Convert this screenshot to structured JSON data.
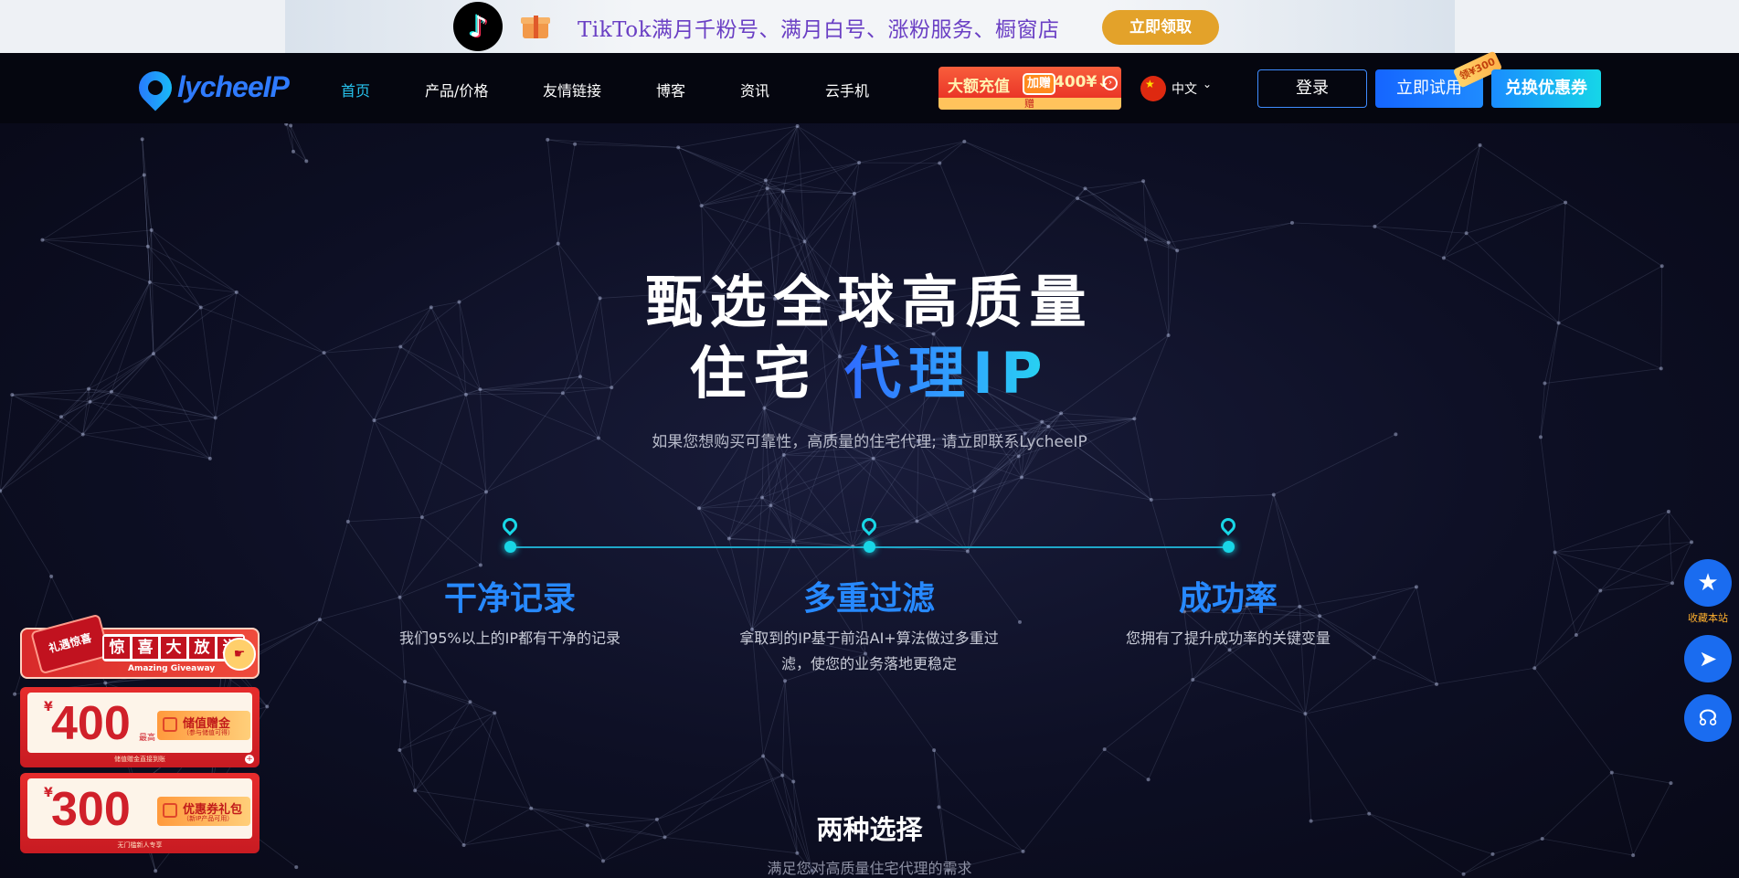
{
  "promo": {
    "tiktok_icon": "tiktok-logo-icon",
    "gift_icon": "gift-icon",
    "text": "TikTok满月千粉号、满月白号、涨粉服务、橱窗店",
    "button": "立即领取"
  },
  "nav": {
    "logo_text": "lycheeIP",
    "items": [
      "首页",
      "产品/价格",
      "友情链接",
      "博客",
      "资讯",
      "云手机"
    ],
    "active_index": 0,
    "recharge": {
      "main": "大额充值",
      "tag": "加赠",
      "amount": "400¥↓",
      "bottom": "赠"
    },
    "language": "中文",
    "login": "登录",
    "trial": "立即试用",
    "trial_badge": "领¥300",
    "coupon": "兑换优惠券"
  },
  "hero": {
    "title_line1": "甄选全球高质量",
    "title_line2_white": "住宅 ",
    "title_line2_blue": "代理IP",
    "subtitle": "如果您想购买可靠性，高质量的住宅代理; 请立即联系LycheeIP",
    "features": [
      {
        "title": "干净记录",
        "desc": "我们95%以上的IP都有干净的记录"
      },
      {
        "title": "多重过滤",
        "desc": "拿取到的IP基于前沿AI+算法做过多重过滤，使您的业务落地更稳定"
      },
      {
        "title": "成功率",
        "desc": "您拥有了提升成功率的关键变量"
      }
    ],
    "section_title": "两种选择",
    "section_subtitle": "满足您对高质量住宅代理的需求"
  },
  "left_promo": {
    "giveaway": {
      "tag": "礼遇惊喜",
      "chars": [
        "惊",
        "喜",
        "大",
        "放",
        "送"
      ],
      "en": "Amazing Giveaway"
    },
    "cards": [
      {
        "yen": "¥",
        "amount": "400",
        "unit": "最高",
        "label": "储值赠金",
        "label_sub": "（参与储值可得）",
        "foot": "储值赠金直接到账",
        "plus": "+"
      },
      {
        "yen": "¥",
        "amount": "300",
        "unit": "",
        "label": "优惠券礼包",
        "label_sub": "（新IP产品可用）",
        "foot": "无门槛新人专享",
        "plus": "+"
      }
    ]
  },
  "float_tools": {
    "bookmark_label": "收藏本站",
    "icons": [
      "star-icon",
      "telegram-icon",
      "customer-service-icon"
    ]
  },
  "colors": {
    "accent_blue": "#2789ff",
    "cyan": "#18d6e6",
    "nav_bg": "#05060f",
    "promo_orange": "#e3a22a"
  }
}
